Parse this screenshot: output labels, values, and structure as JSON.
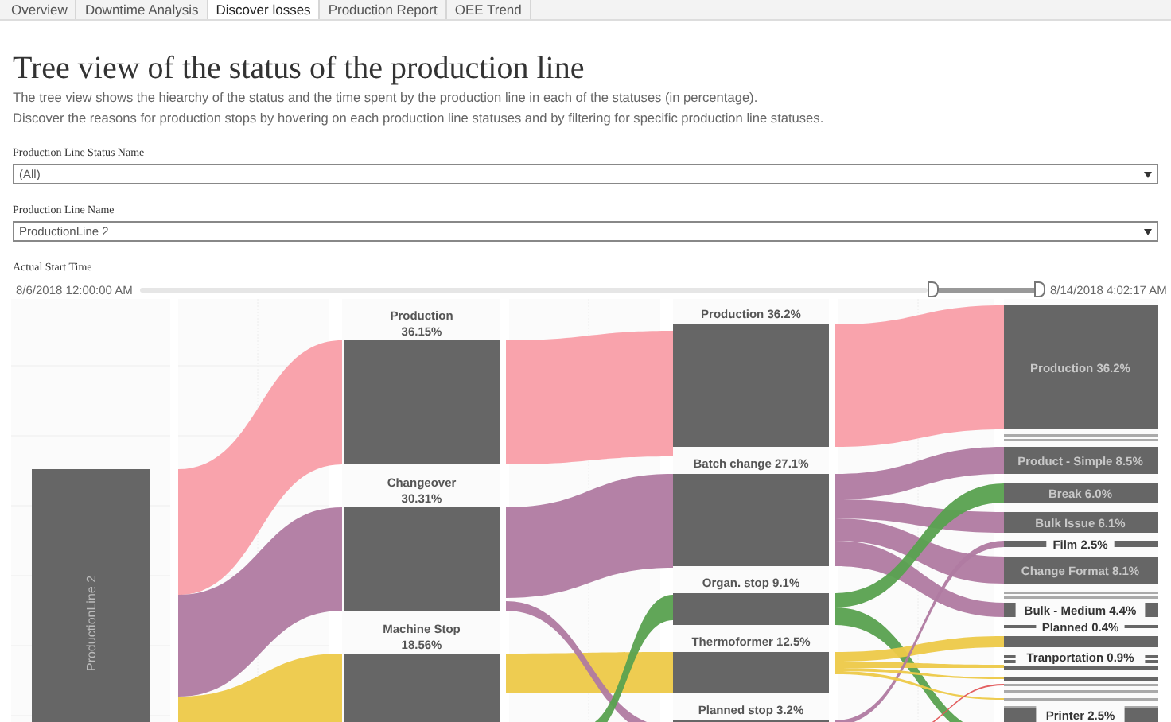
{
  "tabs": [
    {
      "label": "Overview",
      "selected": false
    },
    {
      "label": "Downtime Analysis",
      "selected": false
    },
    {
      "label": "Discover losses",
      "selected": true
    },
    {
      "label": "Production Report",
      "selected": false
    },
    {
      "label": "OEE Trend",
      "selected": false
    }
  ],
  "title": "Tree view of the status of the production line",
  "description": [
    "The tree view shows the hiearchy of the status and the time spent by the production line in each of the statuses (in percentage).",
    "Discover the reasons for production stops by hovering on each production line statuses and by filtering for specific production line statuses."
  ],
  "filters": [
    {
      "label": "Production Line Status Name",
      "value": "(All)"
    },
    {
      "label": "Production Line Name",
      "value": "ProductionLine 2"
    }
  ],
  "time_filter": {
    "label": "Actual Start Time",
    "start": "8/6/2018 12:00:00 AM",
    "end": "8/14/2018 4:02:17 AM"
  },
  "tree": {
    "line": {
      "label": "ProductionLine 2"
    },
    "statuses": [
      {
        "name": "Production",
        "percent": "36.15%"
      },
      {
        "name": "Changeover",
        "percent": "30.31%"
      },
      {
        "name": "Machine Stop",
        "percent": "18.56%"
      }
    ],
    "groups": [
      {
        "label": "Production 36.2%"
      },
      {
        "label": "Batch change 27.1%"
      },
      {
        "label": "Organ. stop 9.1%"
      },
      {
        "label": "Thermoformer 12.5%"
      },
      {
        "label": "Planned stop 3.2%"
      }
    ],
    "reasons": [
      {
        "label": "Production 36.2%"
      },
      {
        "label": "Product - Simple 8.5%"
      },
      {
        "label": "Break 6.0%"
      },
      {
        "label": "Bulk Issue 6.1%"
      },
      {
        "label": "Film 2.5%"
      },
      {
        "label": "Change Format 8.1%"
      },
      {
        "label": "Bulk - Medium 4.4%"
      },
      {
        "label": "Planned 0.4%"
      },
      {
        "label": "Tranportation 0.9%"
      },
      {
        "label": "Printer 2.5%"
      }
    ]
  }
}
